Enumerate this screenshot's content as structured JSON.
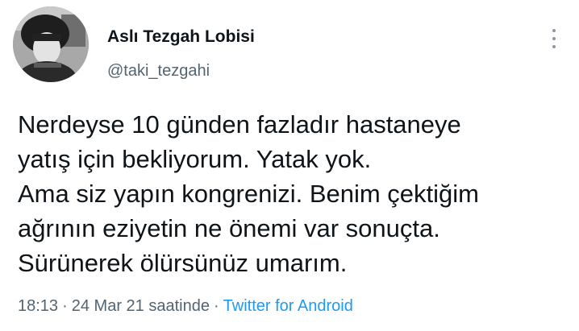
{
  "author": {
    "display_name": "Aslı Tezgah Lobisi",
    "handle": "@taki_tezgahi"
  },
  "tweet": {
    "lines": [
      "Nerdeyse 10 günden fazladır hastaneye",
      "yatış için bekliyorum. Yatak yok.",
      "Ama siz yapın kongrenizi. Benim çektiğim",
      "ağrının eziyetin ne önemi var sonuçta.",
      "Sürünerek ölürsünüz umarım."
    ]
  },
  "meta": {
    "time": "18:13",
    "separator": "·",
    "date": "24 Mar 21 saatinde",
    "source": "Twitter for Android"
  },
  "icons": {
    "more": "more-vertical-icon",
    "avatar": "avatar"
  },
  "colors": {
    "text": "#0f1419",
    "secondary": "#536471",
    "link": "#1d9bf0",
    "background": "#ffffff"
  }
}
